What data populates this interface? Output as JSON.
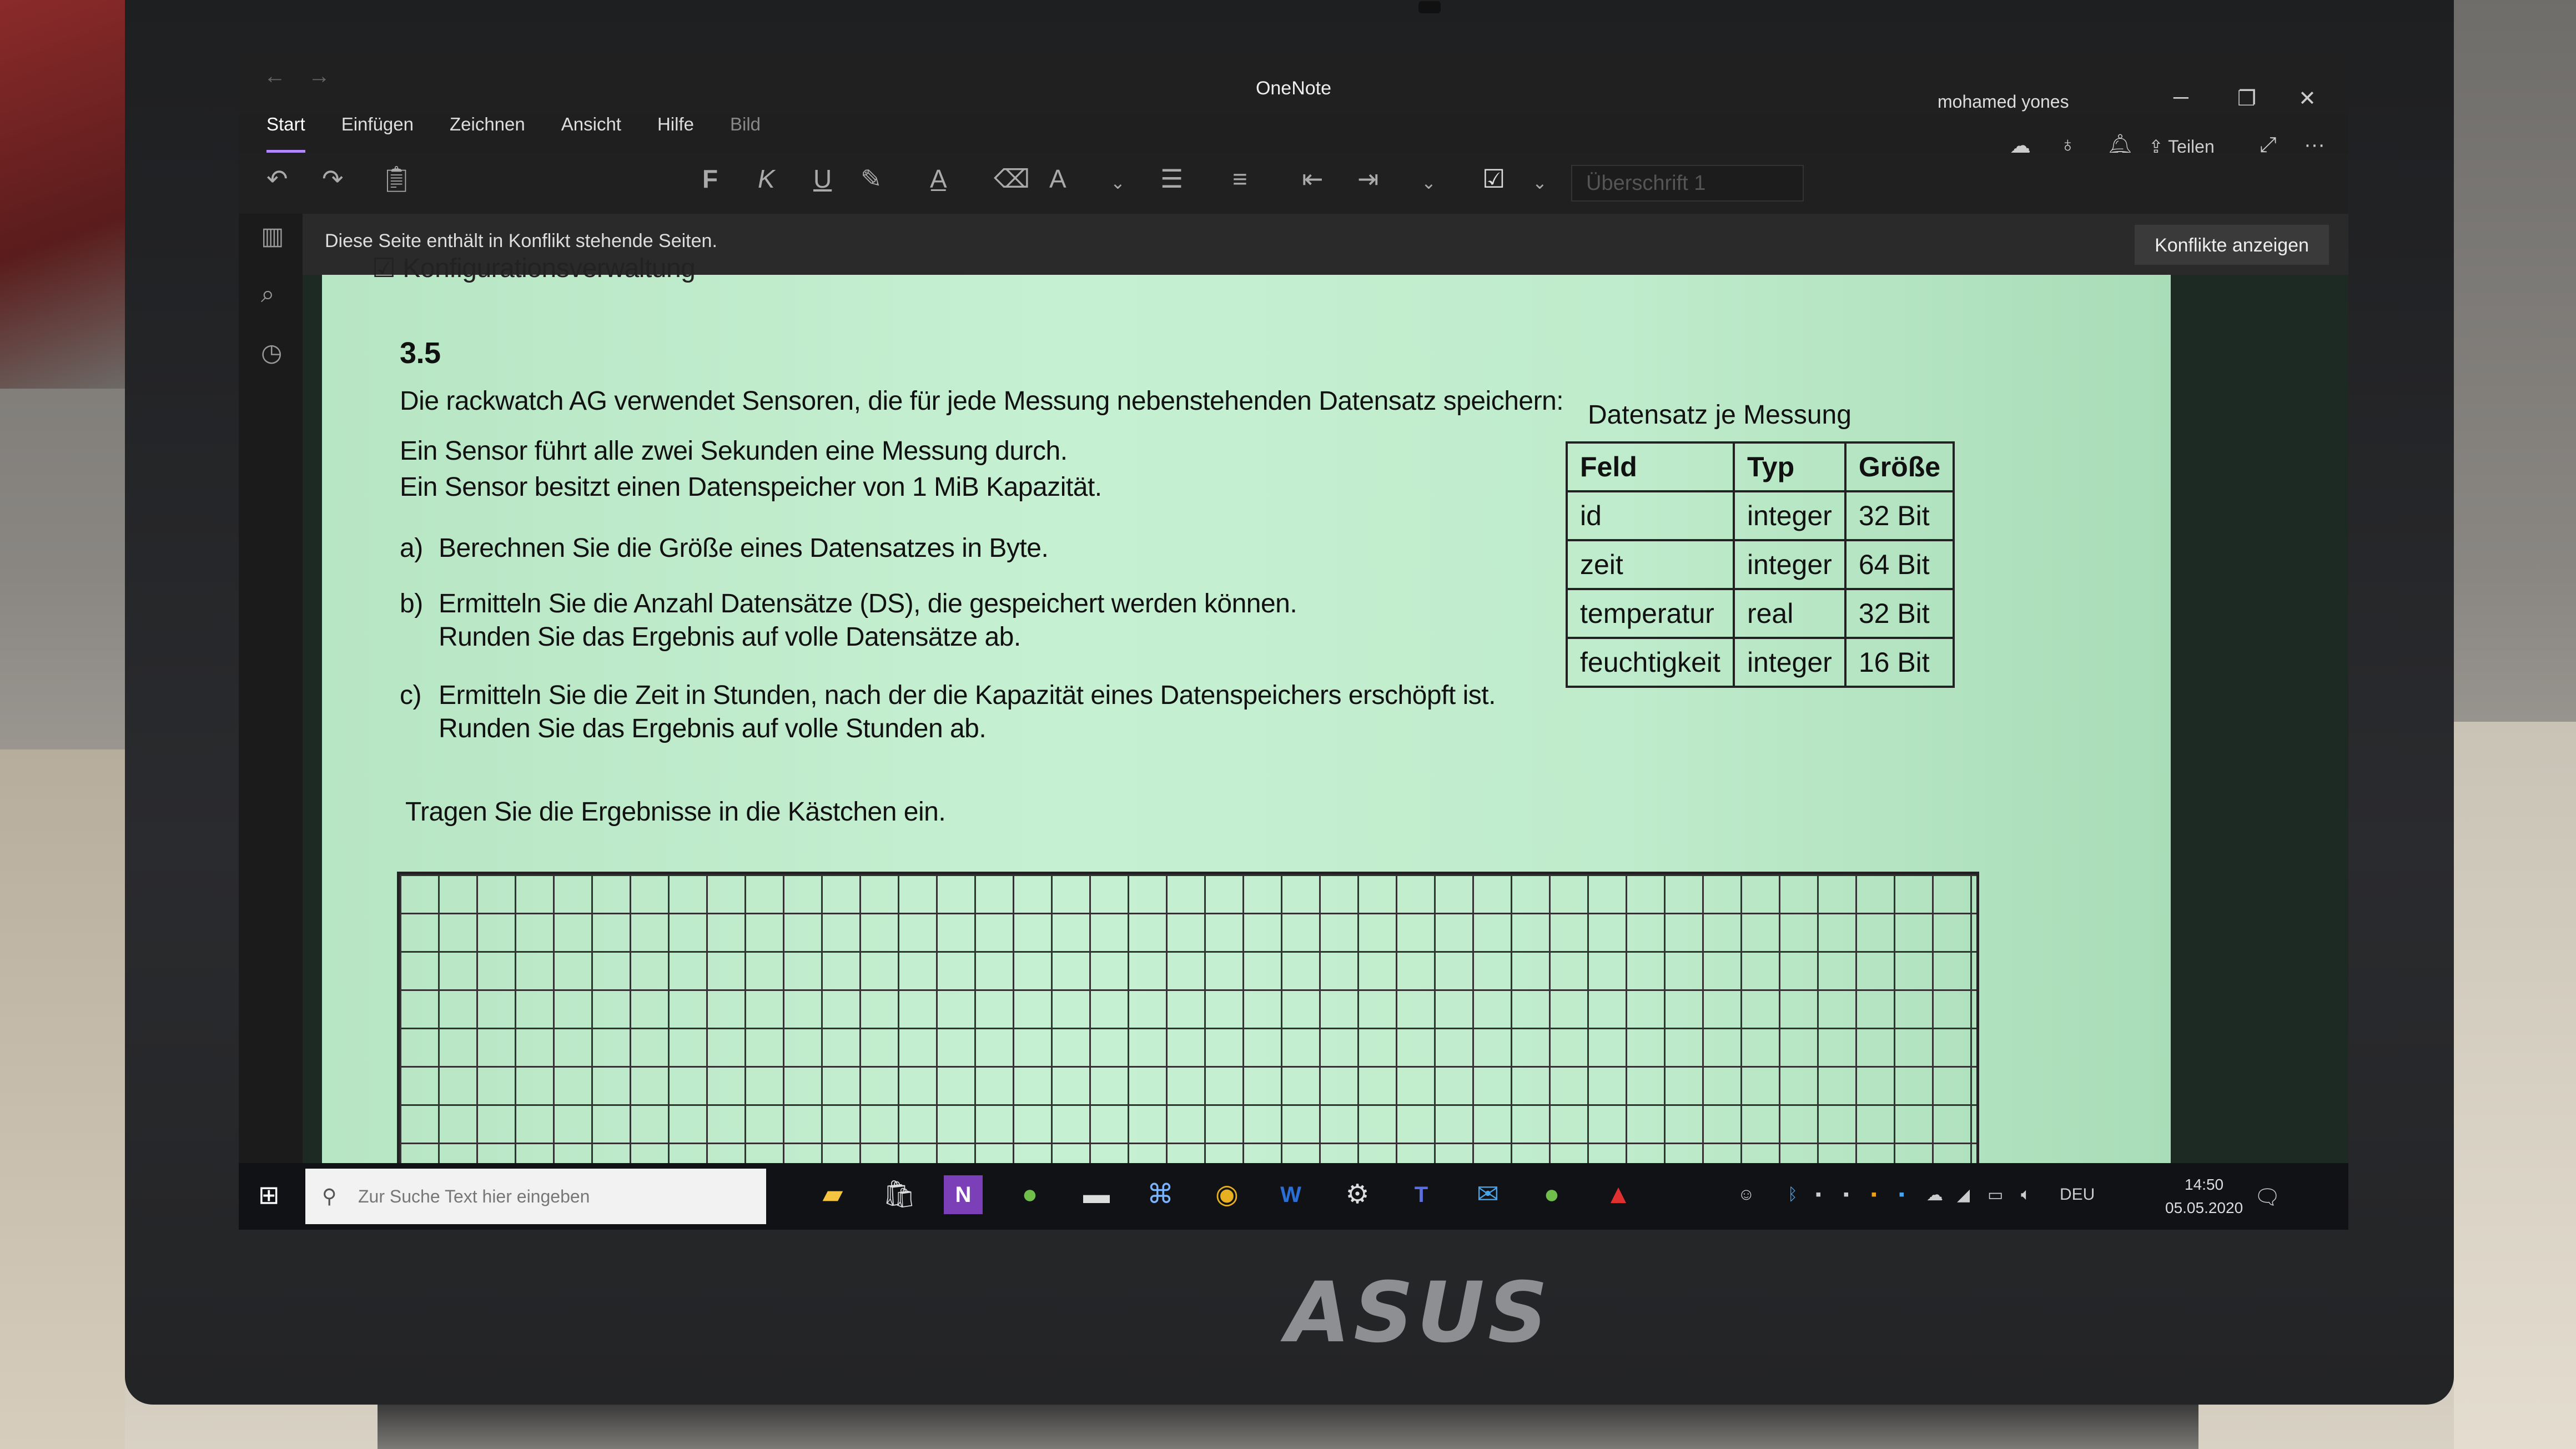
{
  "window": {
    "app_title": "OneNote",
    "user": "mohamed yones",
    "nav_back": "←",
    "nav_forward": "→",
    "minimize": "─",
    "restore": "❐",
    "close": "✕"
  },
  "menu": {
    "tabs": [
      "Start",
      "Einfügen",
      "Zeichnen",
      "Ansicht",
      "Hilfe",
      "Bild"
    ]
  },
  "ribbon": {
    "bold": "F",
    "italic": "K",
    "underline": "U",
    "style_value": "Überschrift 1",
    "share_label": "Teilen",
    "more": "···"
  },
  "banner": {
    "text": "Diese Seite enthält in Konflikt stehende Seiten.",
    "button": "Konflikte anzeigen"
  },
  "page": {
    "prev_line": "☑ Konfigurationsverwaltung",
    "heading": "3.5",
    "intro": "Die rackwatch AG verwendet Sensoren, die für jede Messung nebenstehenden Datensatz speichern:",
    "line1": "Ein Sensor führt alle zwei Sekunden eine Messung durch.",
    "line2": "Ein Sensor besitzt einen Datenspeicher von 1 MiB Kapazität.",
    "task_a_label": "a)",
    "task_a": "Berechnen Sie die Größe eines Datensatzes in Byte.",
    "task_b_label": "b)",
    "task_b_1": "Ermitteln Sie die Anzahl Datensätze (DS), die gespeichert werden können.",
    "task_b_2": "Runden Sie das Ergebnis auf volle Datensätze ab.",
    "task_c_label": "c)",
    "task_c_1": "Ermitteln Sie die Zeit in Stunden, nach der die Kapazität eines Datenspeichers erschöpft ist.",
    "task_c_2": "Runden Sie das Ergebnis auf volle Stunden ab.",
    "instruction": "Tragen Sie die Ergebnisse in die Kästchen ein.",
    "table_caption": "Datensatz je Messung",
    "table_headers": [
      "Feld",
      "Typ",
      "Größe"
    ],
    "table_rows": [
      [
        "id",
        "integer",
        "32 Bit"
      ],
      [
        "zeit",
        "integer",
        "64 Bit"
      ],
      [
        "temperatur",
        "real",
        "32 Bit"
      ],
      [
        "feuchtigkeit",
        "integer",
        "16 Bit"
      ]
    ]
  },
  "taskbar": {
    "search_placeholder": "Zur Suche Text hier eingeben",
    "language": "DEU",
    "time": "14:50",
    "date": "05.05.2020"
  },
  "hardware": {
    "brand": "ASUS"
  }
}
